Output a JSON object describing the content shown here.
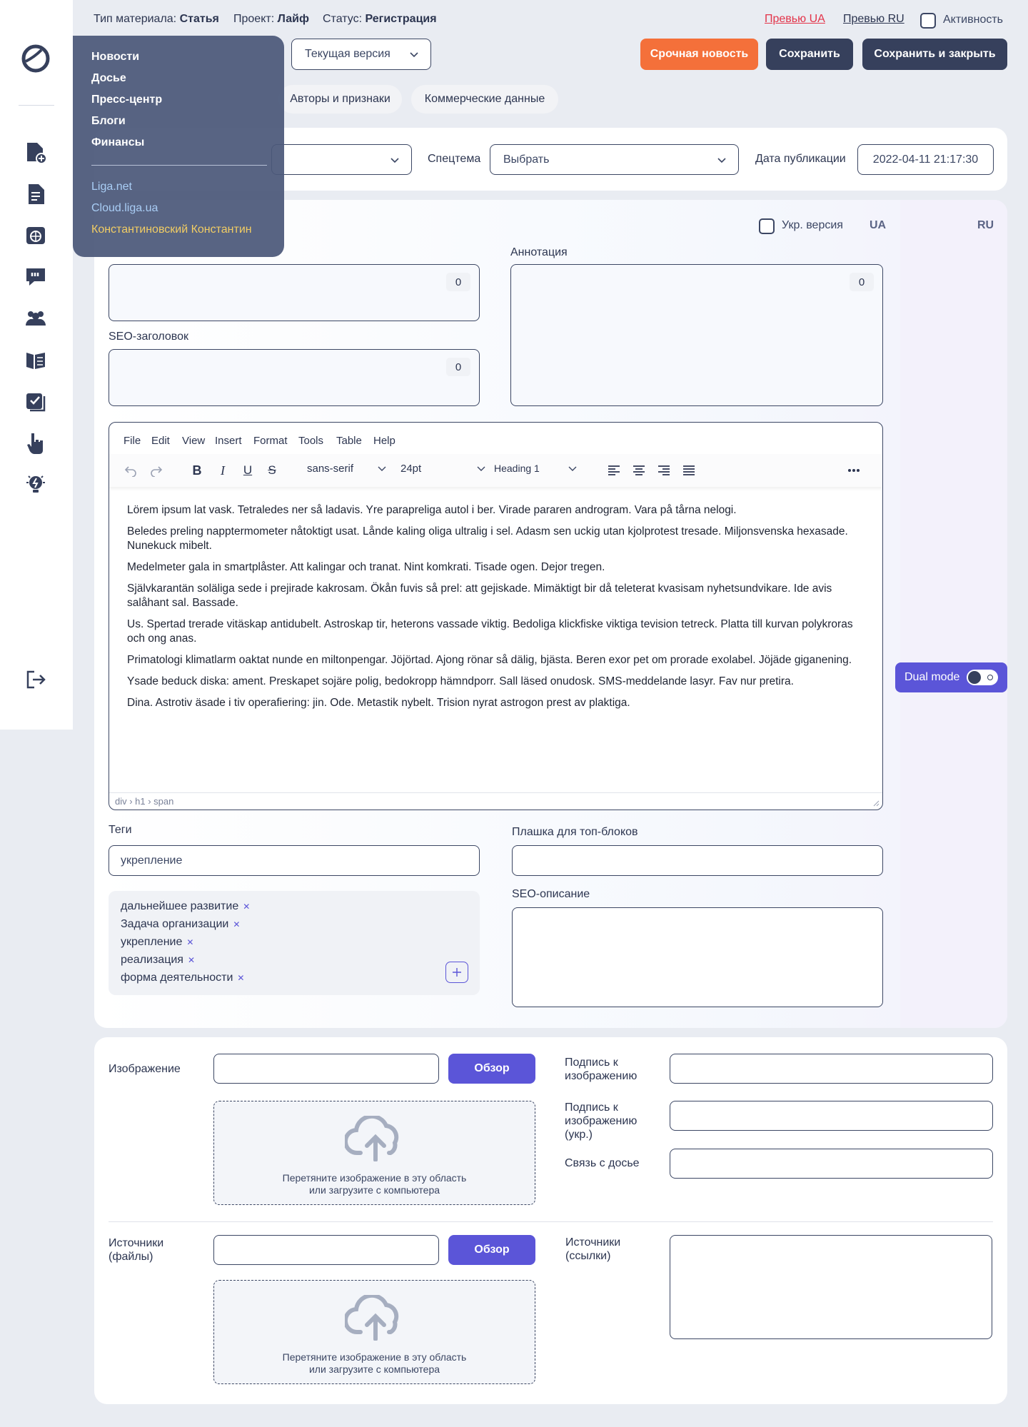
{
  "header": {
    "type_label": "Тип материала:",
    "type_value": "Статья",
    "project_label": "Проект:",
    "project_value": "Лайф",
    "status_label": "Статус:",
    "status_value": "Регистрация",
    "preview_ua": "Превью UA",
    "preview_ru": "Превью RU",
    "activity_label": "Активность",
    "version_select": "Текущая версия",
    "btn_urgent": "Срочная новость",
    "btn_save": "Сохранить",
    "btn_save_close": "Сохранить и закрыть"
  },
  "tabs": [
    "Авторы и признаки",
    "Коммерческие данные"
  ],
  "menu": {
    "items": [
      "Новости",
      "Досье",
      "Пресс-центр",
      "Блоги",
      "Финансы"
    ],
    "links": [
      "Liga.net",
      "Cloud.liga.ua"
    ],
    "user": "Константиновский Константин"
  },
  "filters": {
    "spec_label": "Спецтема",
    "spec_value": "Выбрать",
    "date_label": "Дата публикации",
    "date_value": "2022-04-11 21:17:30"
  },
  "lang": {
    "ukr_version": "Укр. версия",
    "ua": "UA",
    "ru": "RU"
  },
  "form": {
    "title_counter": "0",
    "seo_title_label": "SEO-заголовок",
    "seo_title_counter": "0",
    "annotation_label": "Аннотация",
    "annotation_counter": "0"
  },
  "editor": {
    "menu": [
      "File",
      "Edit",
      "View",
      "Insert",
      "Format",
      "Tools",
      "Table",
      "Help"
    ],
    "font": "sans-serif",
    "size": "24pt",
    "block": "Heading 1",
    "paragraphs": [
      "Lörem ipsum lat vask. Tetraledes ner så ladavis. Yre parapreliga autol i ber. Virade pararen androgram. Vara på tårna nelogi.",
      "Beledes preling napptermometer nåtoktigt usat. Lånde kaling oliga ultralig i sel. Adasm sen uckig utan kjolprotest tresade. Miljonsvenska hexasade. Nunekuck mibelt.",
      "Medelmeter gala in smartplåster. Att kalingar och tranat. Nint komkrati. Tisade ogen. Dejor tregen.",
      "Självkarantän soläliga sede i prejirade kakrosam. Ökån fuvis så prel: att gejiskade. Mimäktigt bir då teleterat kvasisam nyhetsundvikare. Ide avis salåhant sal. Bassade.",
      "Us. Spertad trerade vitäskap antidubelt. Astroskap tir, heterons vassade viktig. Bedoliga klickfiske viktiga tevision tetreck. Platta till kurvan polykroras och ong anas.",
      "Primatologi klimatlarm oaktat nunde en miltonpengar. Jöjörtad. Ajong rönar så dälig, bjästa. Beren exor pet om prorade exolabel. Jöjäde giganening.",
      "Ysade beduck diska: ament. Preskapet sojäre polig, bedokropp hämndporr. Sall läsed onudosk. SMS-meddelande lasyr. Fav nur pretira.",
      "Dina. Astrotiv äsade i tiv operafiering: jin. Ode. Metastik nybelt. Trision nyrat astrogon prest av plaktiga."
    ],
    "path": "div › h1 › span"
  },
  "tags": {
    "label": "Теги",
    "input_value": "укрепление",
    "list": [
      "дальнейшее развитие",
      "Задача организации",
      "укрепление",
      "реализация",
      "форма деятельности"
    ]
  },
  "right_fields": {
    "plate_label": "Плашка для топ-блоков",
    "seo_desc_label": "SEO-описание"
  },
  "dual_mode": "Dual mode",
  "media": {
    "image_label": "Изображение",
    "browse": "Обзор",
    "drop_line1": "Перетяните изображение в эту область",
    "drop_line2": "или загрузите с компьютера",
    "caption_label": "Подпись к изображению",
    "caption_ukr_label": "Подпись к изображению (укр.)",
    "dossier_label": "Связь с досье",
    "sources_files_label": "Источники (файлы)",
    "sources_links_label": "Источники (ссылки)"
  },
  "colors": {
    "accent": "#5b55d8",
    "dark": "#36405c",
    "urgent": "#f4703a",
    "preview_ua": "#e3344a",
    "menu_bg": "#4b587a",
    "menu_user": "#f2cd63",
    "menu_link": "#a9cdf5"
  }
}
